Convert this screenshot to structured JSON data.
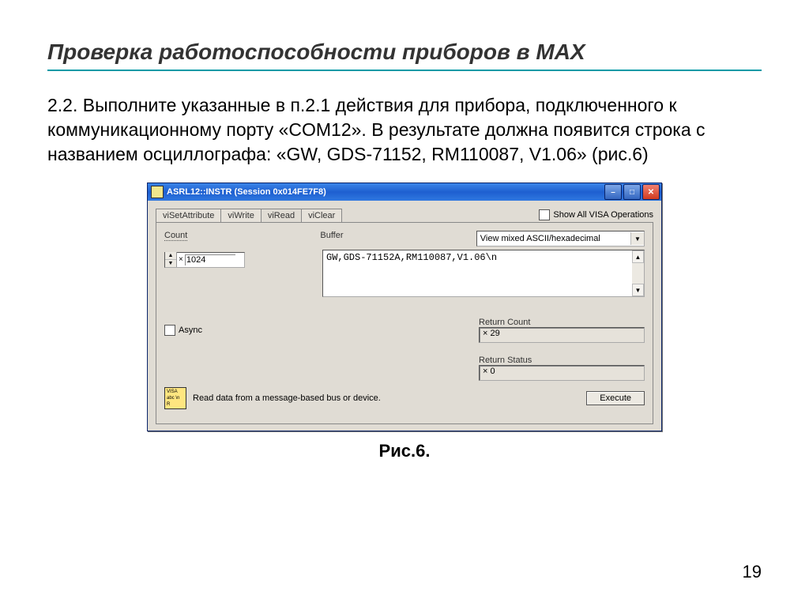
{
  "slide": {
    "title": "Проверка работоспособности  приборов в MAX",
    "body": "2.2. Выполните указанные в п.2.1 действия для прибора, подключенного к коммуникационному порту «COM12». В результате должна появится строка с названием осциллографа: «GW, GDS-71152, RM110087, V1.06» (рис.6)",
    "caption": "Рис.6.",
    "page_number": "19"
  },
  "dialog": {
    "title": "ASRL12::INSTR (Session 0x014FE7F8)",
    "tabs": [
      "viSetAttribute",
      "viWrite",
      "viRead",
      "viClear"
    ],
    "active_tab": "viRead",
    "show_all_label": "Show All VISA Operations",
    "labels": {
      "count": "Count",
      "buffer": "Buffer",
      "async": "Async",
      "return_count": "Return Count",
      "return_status": "Return Status"
    },
    "fields": {
      "count_value": "1024",
      "buffer_mode": "View mixed ASCII/hexadecimal",
      "buffer_text": "GW,GDS-71152A,RM110087,V1.06\\n",
      "return_count": "× 29",
      "return_status": "× 0"
    },
    "hint": "Read data from a message-based bus or device.",
    "execute_button": "Execute",
    "visa_icon_text": [
      "VISA",
      "abc \\n",
      "R"
    ]
  }
}
